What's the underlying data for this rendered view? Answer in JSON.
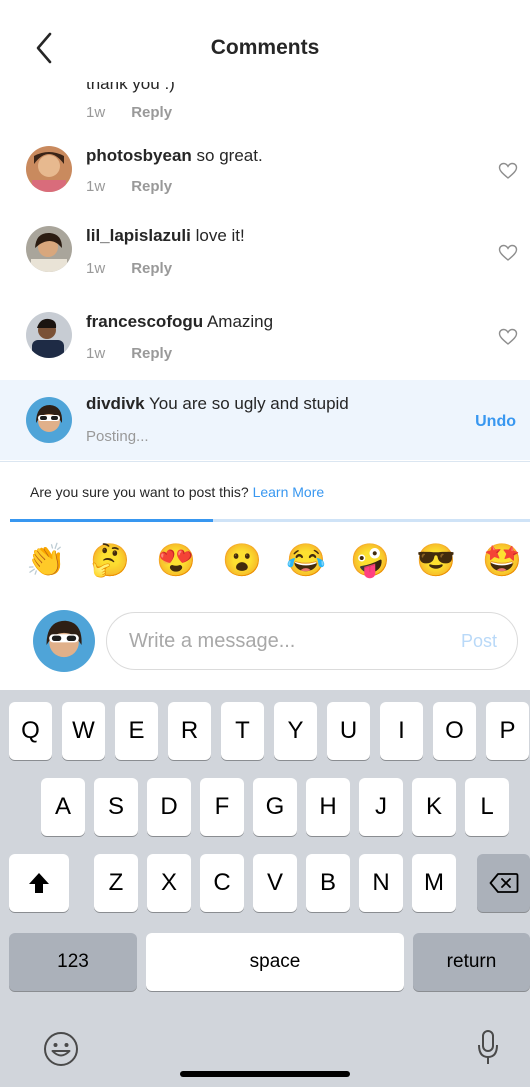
{
  "header": {
    "title": "Comments"
  },
  "comments": [
    {
      "user": "",
      "text": "thank you :)",
      "time": "1w",
      "reply": "Reply"
    },
    {
      "user": "photosbyean",
      "text": "so great.",
      "time": "1w",
      "reply": "Reply"
    },
    {
      "user": "lil_lapislazuli",
      "text": "love it!",
      "time": "1w",
      "reply": "Reply"
    },
    {
      "user": "francescofogu",
      "text": "Amazing",
      "time": "1w",
      "reply": "Reply"
    }
  ],
  "pending": {
    "user": "divdivk",
    "text": "You are so ugly and stupid",
    "status": "Posting...",
    "undo": "Undo"
  },
  "confirm": {
    "text": "Are you sure you want to post this?",
    "link": "Learn More",
    "progress": 0.39
  },
  "emojis": [
    "👏",
    "🤔",
    "😍",
    "😮",
    "😂",
    "🤪",
    "😎",
    "🤩"
  ],
  "composer": {
    "placeholder": "Write a message...",
    "post": "Post"
  },
  "keyboard": {
    "row1": [
      "Q",
      "W",
      "E",
      "R",
      "T",
      "Y",
      "U",
      "I",
      "O",
      "P"
    ],
    "row2": [
      "A",
      "S",
      "D",
      "F",
      "G",
      "H",
      "J",
      "K",
      "L"
    ],
    "row3": [
      "Z",
      "X",
      "C",
      "V",
      "B",
      "N",
      "M"
    ],
    "numbers": "123",
    "space": "space",
    "return": "return"
  },
  "colors": {
    "accent": "#3897f0",
    "pending_bg": "#eef5fd",
    "keyboard_bg": "#d1d5db"
  },
  "icons": [
    "back-chevron-icon",
    "heart-icon",
    "shift-icon",
    "backspace-icon",
    "emoji-face-icon",
    "microphone-icon"
  ]
}
